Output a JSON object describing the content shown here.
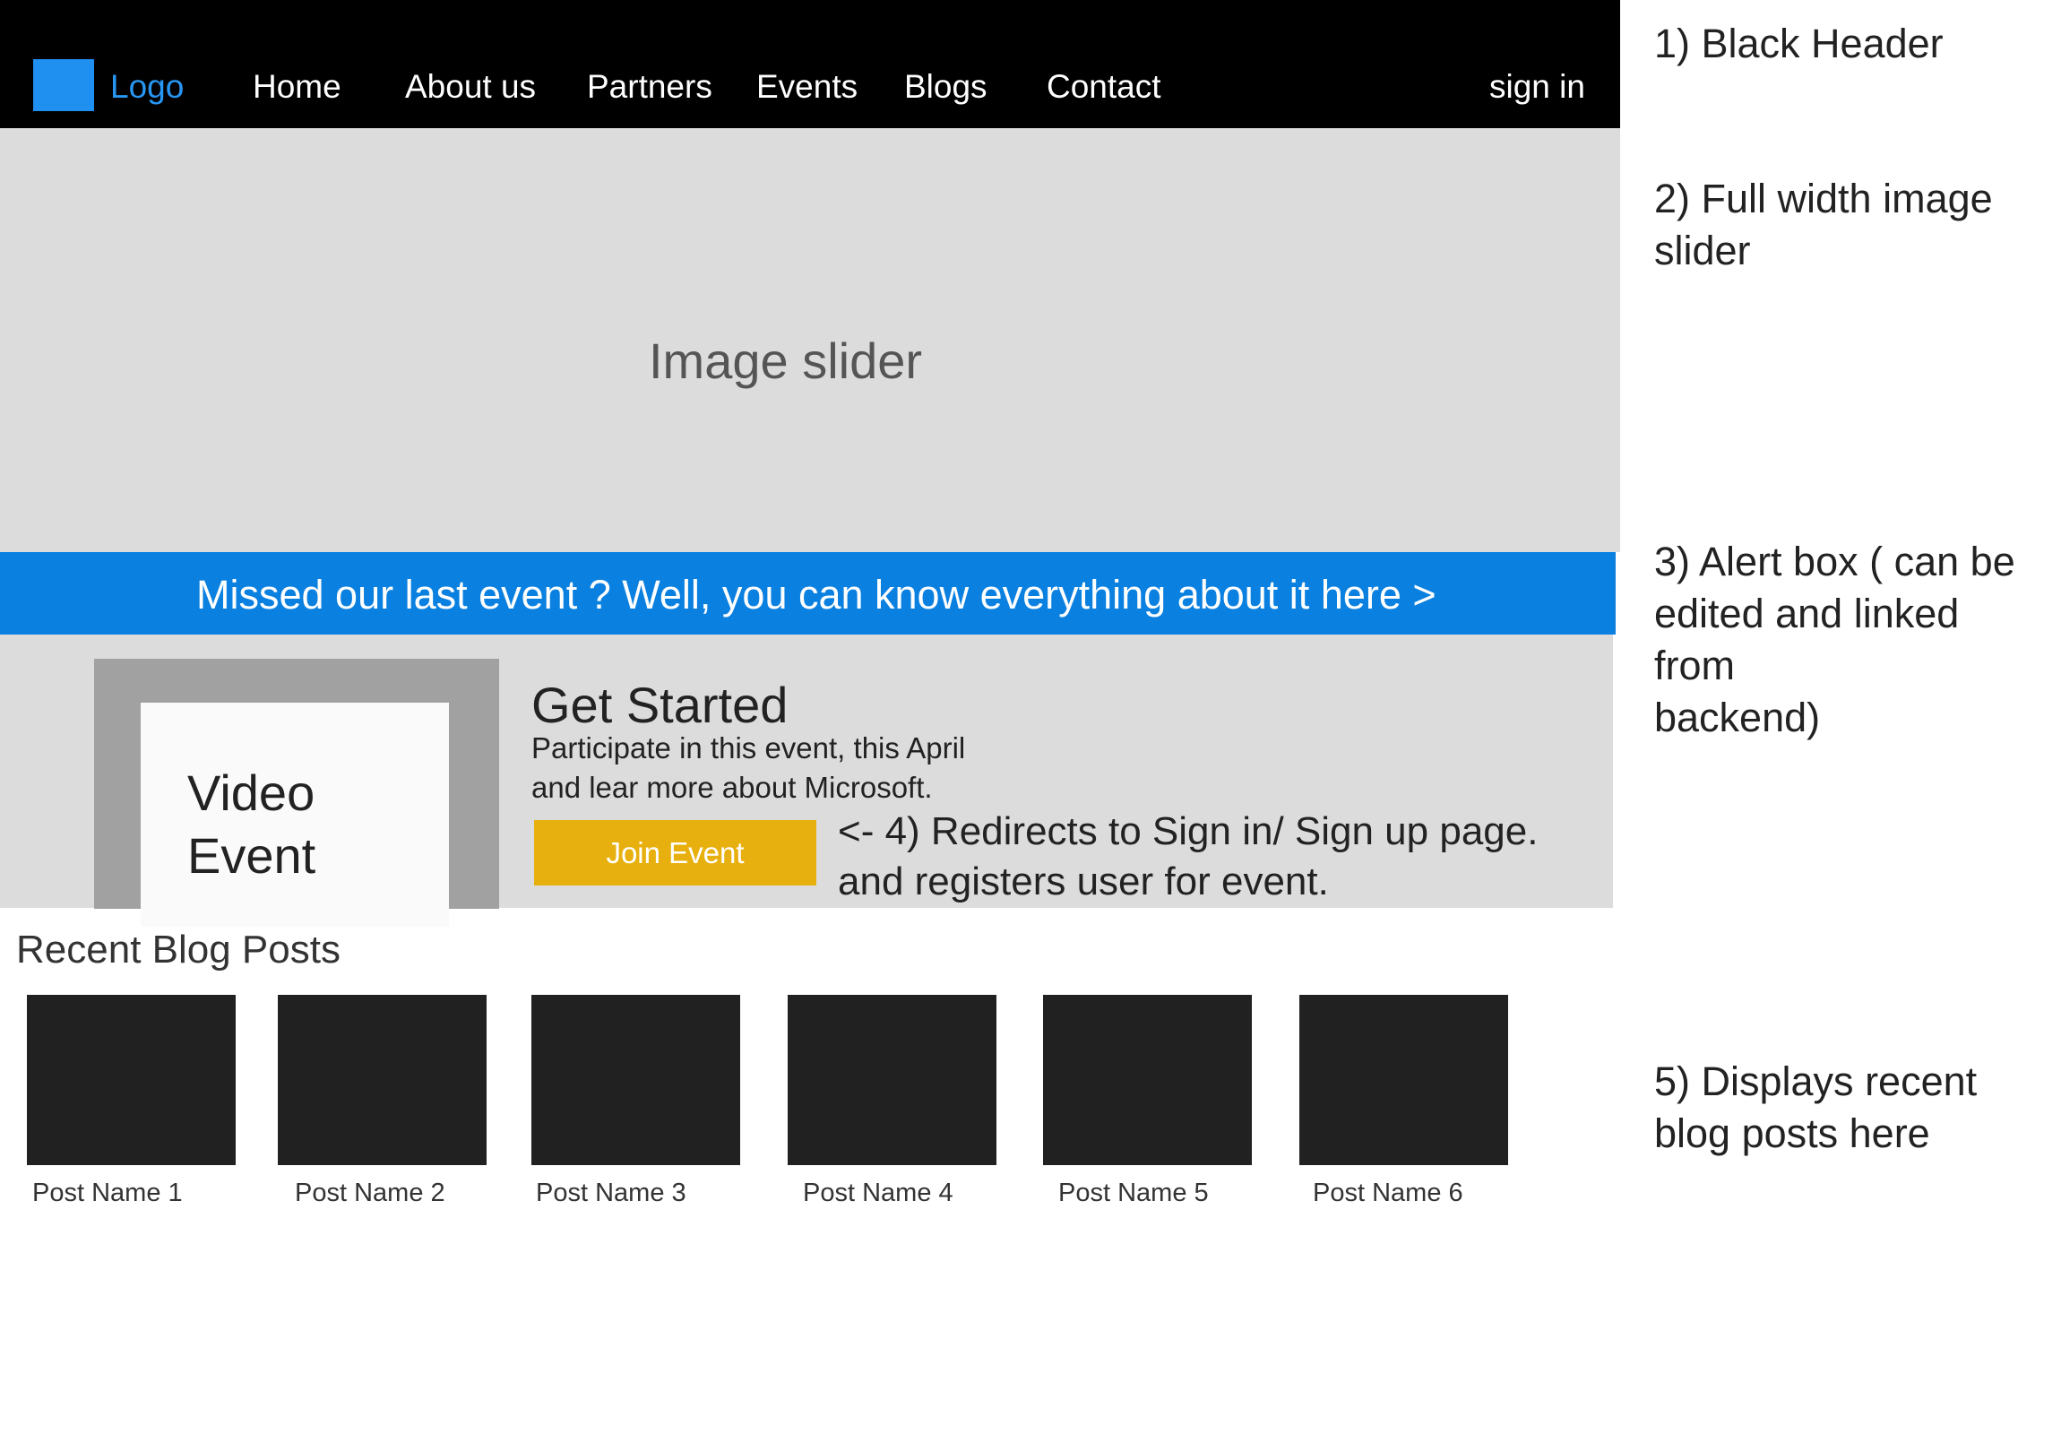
{
  "header": {
    "logo_label": "Logo",
    "nav": [
      "Home",
      "About us",
      "Partners",
      "Events",
      "Blogs",
      "Contact"
    ],
    "signin_label": "sign in",
    "background_color": "#000000",
    "logo_color": "#1f8ff0"
  },
  "slider": {
    "label": "Image slider"
  },
  "alert": {
    "text": "Missed our last event ? Well, you can know everything about it here >",
    "color": "#0a80e0"
  },
  "get_started": {
    "video_label_line1": "Video",
    "video_label_line2": "Event",
    "title": "Get Started",
    "desc_line1": "Participate in this event, this April",
    "desc_line2": "and lear more about Microsoft.",
    "button_label": "Join Event",
    "button_color": "#e8b00e",
    "note_line1": "<- 4) Redirects to Sign in/ Sign up page.",
    "note_line2": "and registers user for event."
  },
  "blog": {
    "heading": "Recent Blog Posts",
    "posts": [
      "Post Name 1",
      "Post Name 2",
      "Post Name 3",
      "Post Name 4",
      "Post Name 5",
      "Post Name 6"
    ]
  },
  "annotations": {
    "a1": "1) Black Header",
    "a2_line1": "2) Full width image",
    "a2_line2": "slider",
    "a3_line1": "3) Alert box ( can be",
    "a3_line2": "edited and linked from",
    "a3_line3": "backend)",
    "a5_line1": "5) Displays recent",
    "a5_line2": "blog posts here"
  }
}
